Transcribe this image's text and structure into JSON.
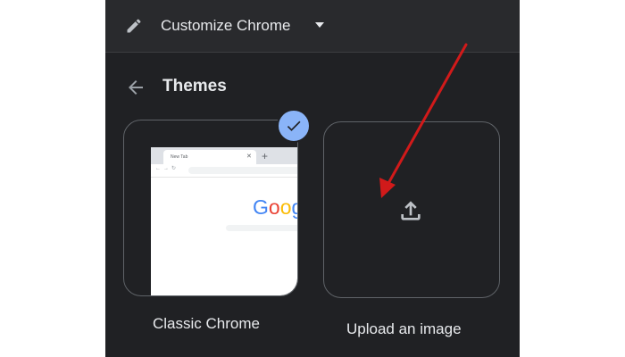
{
  "header": {
    "title": "Customize Chrome",
    "edit_icon": "pencil-icon",
    "dropdown_icon": "caret-down-icon"
  },
  "themes": {
    "title": "Themes",
    "back_icon": "arrow-back-icon",
    "items": [
      {
        "label": "Classic Chrome",
        "selected": true,
        "preview": {
          "tab_label": "New Tab",
          "logo_text": "Goog"
        }
      },
      {
        "label": "Upload an image",
        "icon": "upload-icon"
      }
    ]
  },
  "colors": {
    "panel_bg": "#202124",
    "header_bg": "#292a2d",
    "text": "#e8eaed",
    "selected_badge": "#8ab4f8",
    "annotation_arrow": "#d11a1a"
  }
}
